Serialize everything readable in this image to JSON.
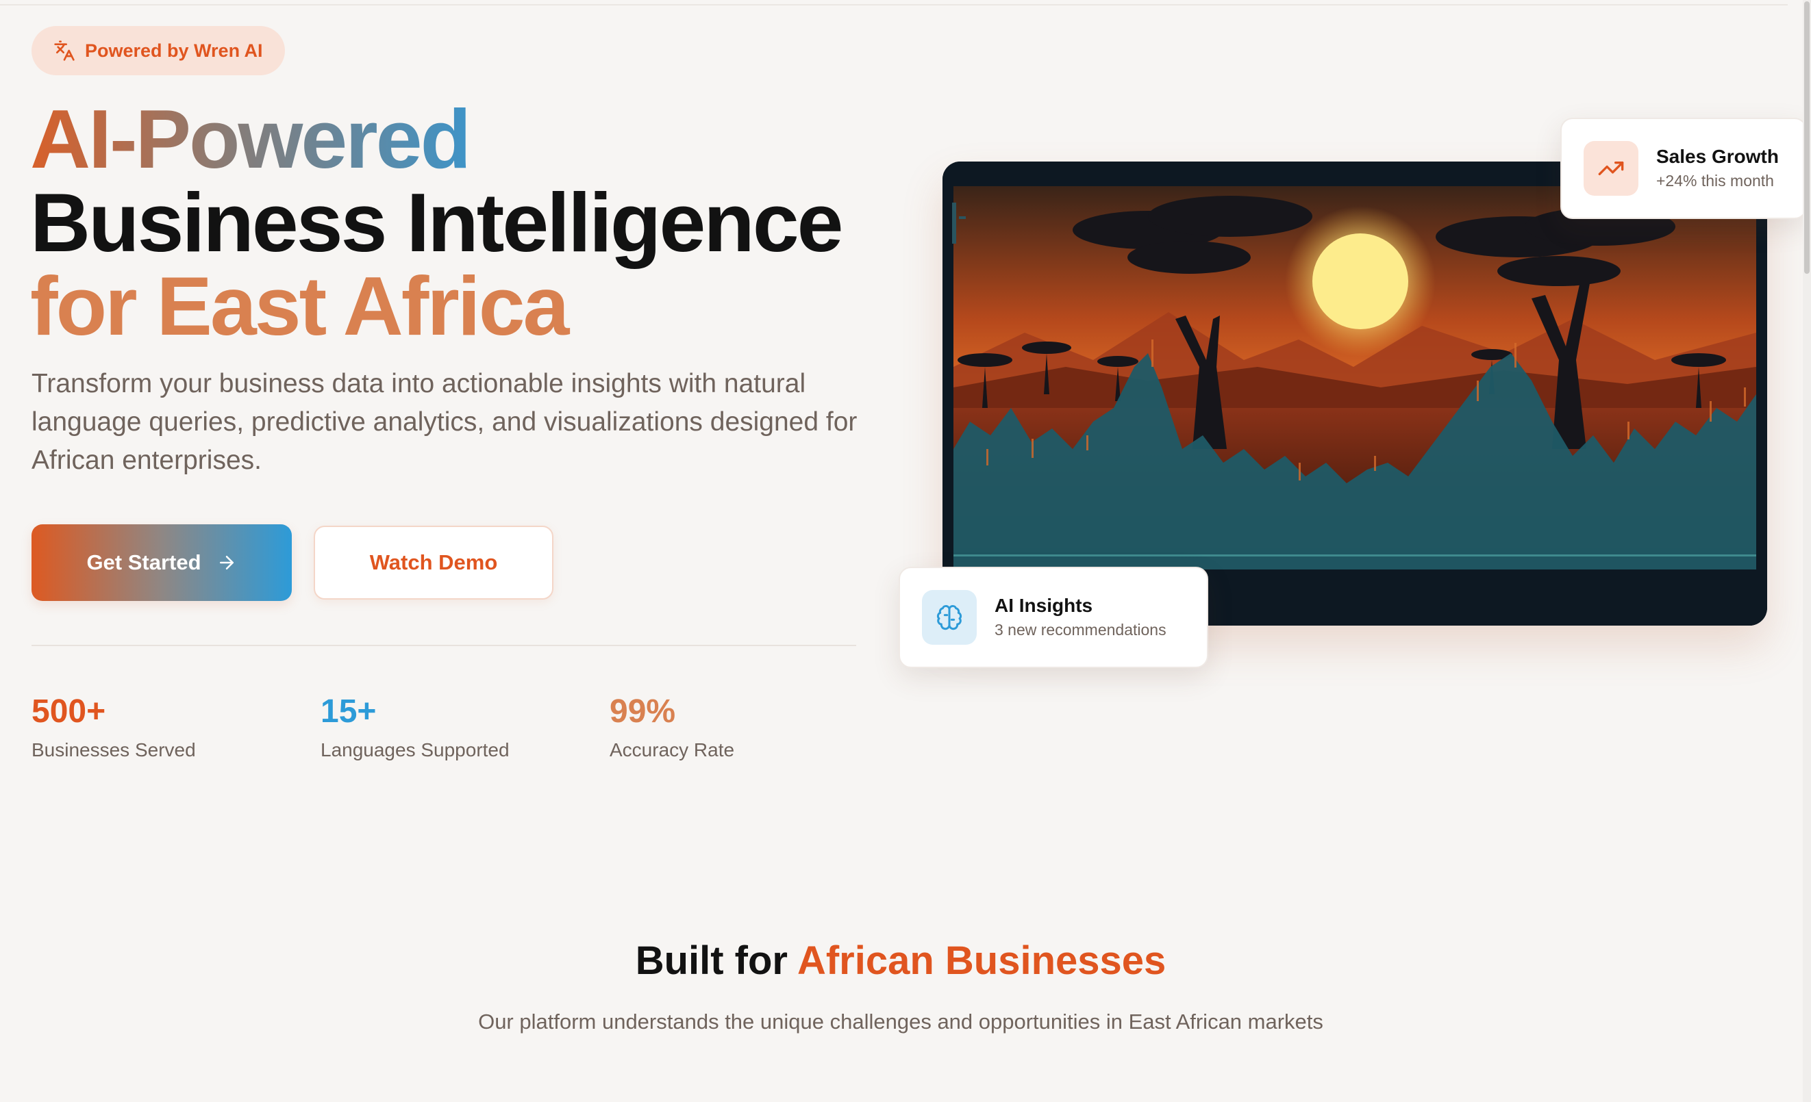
{
  "badge": {
    "icon": "translate-icon",
    "label": "Powered by Wren AI"
  },
  "hero": {
    "title_line1": "AI-Powered",
    "title_line2": "Business Intelligence",
    "title_line3": "for East Africa",
    "description": "Transform your business data into actionable insights with natural language queries, predictive analytics, and visualizations designed for African enterprises.",
    "primary_button": "Get Started",
    "secondary_button": "Watch Demo"
  },
  "stats": [
    {
      "value": "500+",
      "label": "Businesses Served",
      "color": "#e0551f"
    },
    {
      "value": "15+",
      "label": "Languages Supported",
      "color": "#2d9bd8"
    },
    {
      "value": "99%",
      "label": "Accuracy Rate",
      "color": "#d98150"
    }
  ],
  "cards": {
    "sales": {
      "icon": "trending-up-icon",
      "title": "Sales Growth",
      "subtitle": "+24% this month"
    },
    "ai": {
      "icon": "brain-icon",
      "title": "AI Insights",
      "subtitle": "3 new recommendations"
    }
  },
  "section": {
    "title_prefix": "Built for ",
    "title_accent": "African Businesses",
    "subtitle": "Our platform understands the unique challenges and opportunities in East African markets"
  },
  "colors": {
    "accent_orange": "#e0551f",
    "accent_blue": "#2d9bd8",
    "accent_tan": "#d98150",
    "background": "#f7f5f3"
  }
}
